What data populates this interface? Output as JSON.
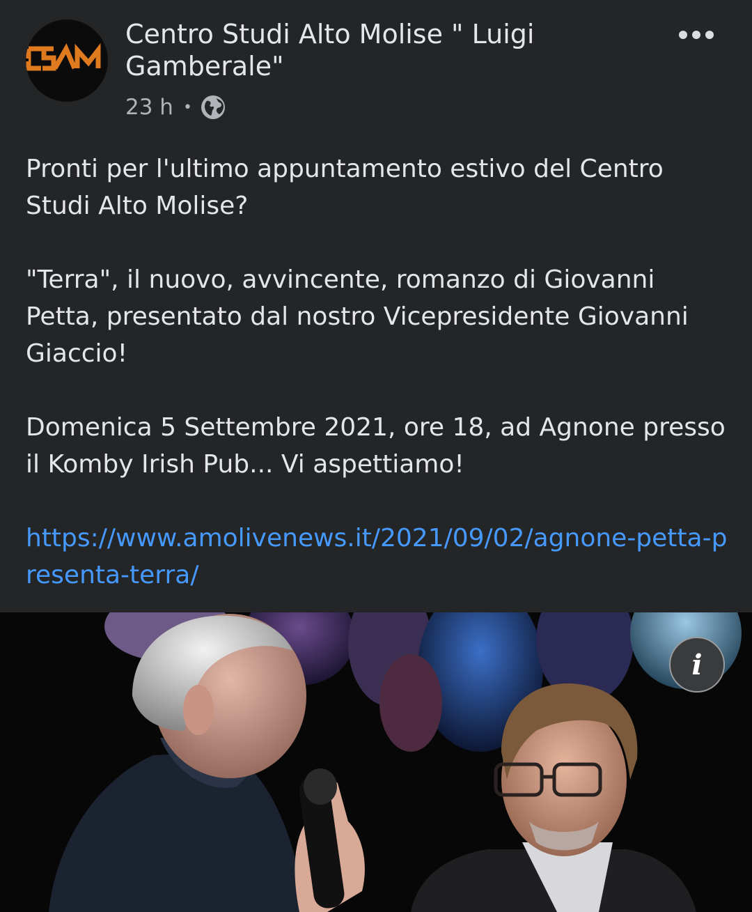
{
  "post": {
    "page_name": "Centro Studi Alto Molise \" Luigi Gamberale\"",
    "avatar_logo_text": "CSAM",
    "timestamp": "23 h",
    "separator": "•",
    "privacy_icon": "globe-icon",
    "more_icon": "more-options-icon",
    "paragraphs": [
      "Pronti per l'ultimo appuntamento estivo del Centro Studi Alto Molise?",
      "\"Terra\", il nuovo, avvincente, romanzo di Giovanni Petta, presentato dal nostro Vicepresidente Giovanni Giaccio!",
      "Domenica 5 Settembre 2021, ore 18, ad Agnone presso il Komby Irish Pub... Vi aspettiamo!"
    ],
    "link": "https://www.amolivenews.it/2021/09/02/agnone-petta-presenta-terra/"
  },
  "photo": {
    "info_label": "i",
    "info_icon": "info-icon"
  },
  "colors": {
    "background": "#242526",
    "text": "#e4e6eb",
    "secondary_text": "#b0b3b8",
    "link": "#4599ff",
    "logo_orange": "#e07a1f"
  }
}
